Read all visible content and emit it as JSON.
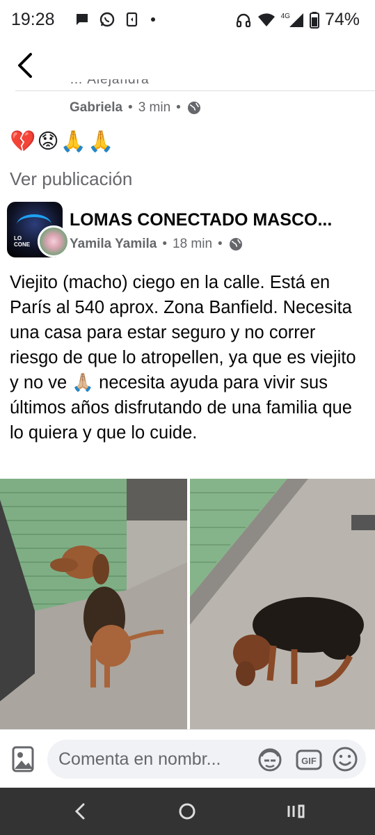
{
  "status_bar": {
    "time": "19:28",
    "network": "4G",
    "battery": "74%",
    "icons": [
      "chat-bubble-icon",
      "whatsapp-icon",
      "screenshot-icon",
      "dot-icon",
      "headphones-icon",
      "wifi-icon",
      "signal-icon",
      "battery-icon"
    ]
  },
  "nav": {
    "back_icon": "back-arrow-icon"
  },
  "previous_comment": {
    "cut_text": "… Alejandra",
    "author": "Gabriela",
    "time": "3 min",
    "privacy_icon": "globe-icon"
  },
  "emoji_reactions": "💔😟🙏🙏",
  "view_post_label": "Ver publicación",
  "post": {
    "group_name": "LOMAS CONECTADO MASCO...",
    "author": "Yamila Yamila",
    "time": "18 min",
    "privacy_icon": "globe-icon",
    "text": "Viejito (macho) ciego en la calle. Está en París al 540 aprox. Zona  Banfield. Necesita una casa para estar seguro y no correr riesgo de que lo atropellen, ya que es viejito y no ve 🙏🏼 necesita ayuda  para vivir sus últimos años disfrutando de una familia que lo quiera y que lo cuide.",
    "photos": [
      "dog-sitting-photo",
      "dog-standing-photo"
    ]
  },
  "comment_bar": {
    "placeholder": "Comenta en nombr...",
    "gif_label": "GIF"
  },
  "colors": {
    "secondary_text": "#65676b",
    "primary_text": "#050505",
    "input_bg": "#f0f2f5",
    "nav_bar_bg": "#333333"
  }
}
